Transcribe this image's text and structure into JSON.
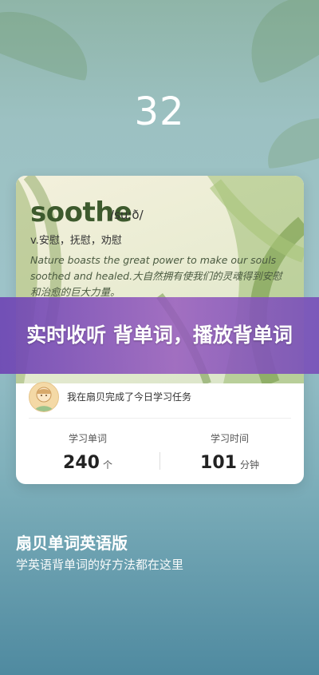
{
  "day_count": "32",
  "word_card": {
    "word": "soothe",
    "phonetic": "/suːð/",
    "meaning": "v.安慰，抚慰，劝慰",
    "example": "Nature boasts the great power to make our souls soothed and healed.大自然拥有使我们的灵魂得到安慰和治愈的巨大力量。"
  },
  "overlay_banner": "实时收听 背单词，播放背单词",
  "user_row": {
    "avatar_icon": "user-avatar-icon",
    "text": "我在扇贝完成了今日学习任务"
  },
  "stats": [
    {
      "label": "学习单词",
      "value": "240",
      "unit": "个"
    },
    {
      "label": "学习时间",
      "value": "101",
      "unit": "分钟"
    }
  ],
  "app": {
    "title": "扇贝单词英语版",
    "subtitle": "学英语背单词的好方法都在这里"
  },
  "colors": {
    "accent": "#3d5a2d",
    "banner": "#7a4fb8"
  }
}
